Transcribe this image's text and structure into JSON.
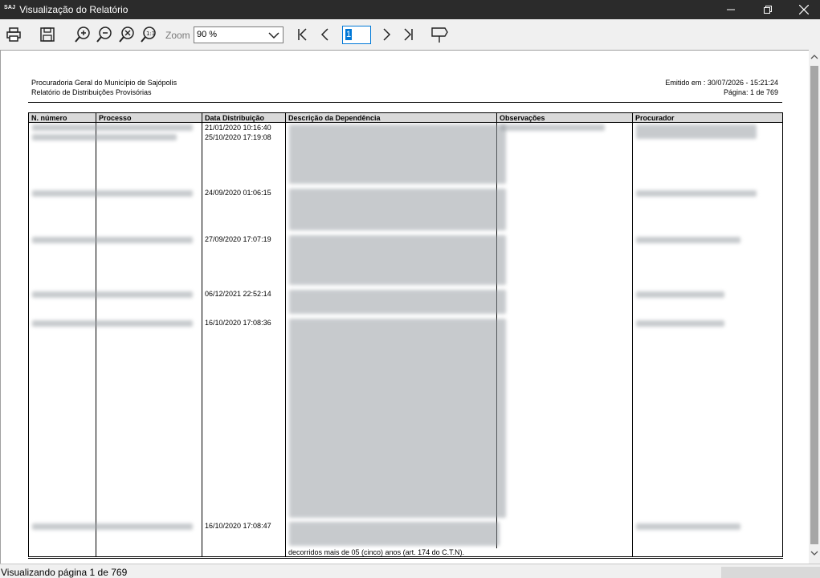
{
  "window": {
    "logo": "SAJ",
    "title": "Visualização do Relatório",
    "minimize_icon": "minimize-icon",
    "maximize_icon": "restore-icon",
    "close_icon": "close-icon"
  },
  "toolbar": {
    "icons": [
      "print-icon",
      "save-icon",
      "zoom-in-icon",
      "zoom-out-icon",
      "zoom-fit-icon",
      "zoom-actual-icon",
      "first-page-icon",
      "prev-page-icon",
      "next-page-icon",
      "last-page-icon",
      "flag-icon"
    ],
    "zoom_label": "Zoom",
    "zoom_value": "90 %",
    "page_value": "1"
  },
  "report": {
    "org": "Procuradoria Geral do Município de Sajópolis",
    "name": "Relatório de Distribuições Provisórias",
    "emitted": "Emitido em : 30/07/2026 - 15:21:24",
    "page": "Página: 1 de 769",
    "columns": [
      "N. número",
      "Processo",
      "Data Distribuição",
      "Descrição da Dependência",
      "Observações",
      "Procurador"
    ],
    "dates": [
      "21/01/2020 10:16:40",
      "25/10/2020 17:19:08",
      "24/09/2020 01:06:15",
      "27/09/2020 17:07:19",
      "06/12/2021 22:52:14",
      "16/10/2020 17:08:36",
      "16/10/2020 17:08:47"
    ],
    "desc_last_line": "decorridos mais de 05 (cinco) anos (art. 174 do C.T.N)."
  },
  "status": {
    "text": "Visualizando página 1 de 769"
  }
}
